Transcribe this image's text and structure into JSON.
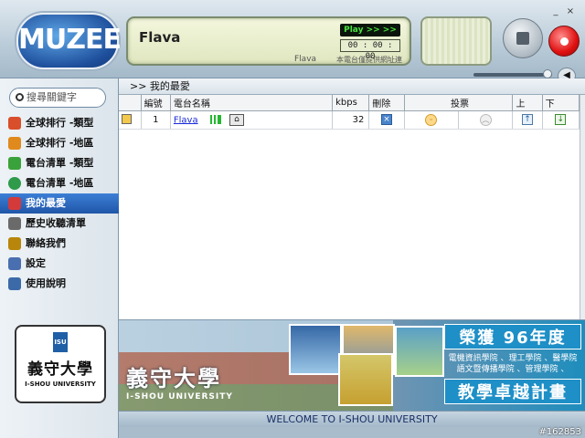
{
  "app": {
    "logo_text": "MUZEE"
  },
  "player": {
    "station_name": "Flava",
    "play_status": "Play >> >>",
    "timer": "00 : 00 : 00",
    "sub_station": "Flava",
    "sub_note": "本電台僅提供網址連",
    "volume_level": 0.9
  },
  "search": {
    "placeholder": "搜尋關鍵字"
  },
  "nav": [
    {
      "label": "全球排行 -類型",
      "icon": "globe-genre-icon",
      "color": "#d94f2b"
    },
    {
      "label": "全球排行 -地區",
      "icon": "globe-region-icon",
      "color": "#e08a1e"
    },
    {
      "label": "電台清單 -類型",
      "icon": "music-note-icon",
      "color": "#3aa23a"
    },
    {
      "label": "電台清單 -地區",
      "icon": "earth-icon",
      "color": "#2e9a4a"
    },
    {
      "label": "我的最愛",
      "icon": "heart-icon",
      "color": "#d43a3a",
      "selected": true
    },
    {
      "label": "歷史收聽清單",
      "icon": "history-icon",
      "color": "#6a6a6a"
    },
    {
      "label": "聯絡我們",
      "icon": "contact-icon",
      "color": "#b8860b"
    },
    {
      "label": "設定",
      "icon": "settings-icon",
      "color": "#4a6fb0"
    },
    {
      "label": "使用說明",
      "icon": "help-book-icon",
      "color": "#3c6aa8"
    }
  ],
  "breadcrumb": ">> 我的最愛",
  "table": {
    "headers": [
      "",
      "編號",
      "電台名稱",
      "kbps",
      "刪除",
      "投票",
      "",
      "上",
      "下"
    ],
    "rows": [
      {
        "num": "1",
        "name": "Flava",
        "kbps": "32"
      }
    ]
  },
  "school": {
    "name_zh": "義守大學",
    "name_en": "I-SHOU UNIVERSITY",
    "mark": "ISU"
  },
  "banner": {
    "school_zh": "義守大學",
    "school_en": "I-SHOU UNIVERSITY",
    "award_line1": "榮獲 96年度",
    "award_desc1": "電機資訊學院 、理工學院 、醫學院",
    "award_desc2": "語文暨傳播學院 、管理學院 、",
    "award_line2": "教學卓越計畫"
  },
  "status": {
    "welcome": "WELCOME TO I-SHOU UNIVERSITY"
  },
  "watermark": "#162853"
}
